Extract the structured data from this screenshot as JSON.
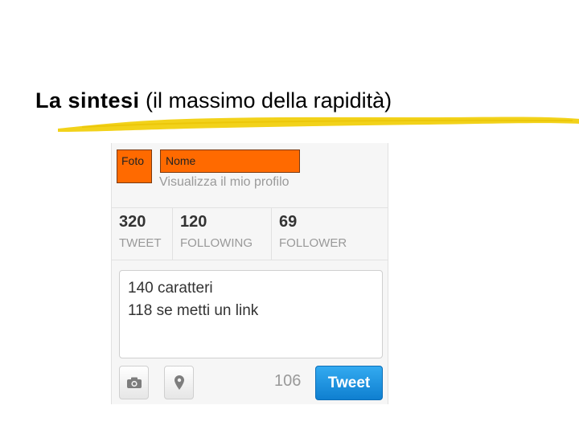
{
  "slide": {
    "title_bold": "La sintesi",
    "title_rest": " (il massimo della rapidità)"
  },
  "profile": {
    "photo_label": "Foto",
    "name_label": "Nome",
    "profile_link": "Visualizza il mio profilo"
  },
  "stats": [
    {
      "value": "320",
      "label": "TWEET"
    },
    {
      "value": "120",
      "label": "FOLLOWING"
    },
    {
      "value": "69",
      "label": "FOLLOWER"
    }
  ],
  "composer": {
    "line1": "140 caratteri",
    "line2": "118 se metti un link"
  },
  "toolbar": {
    "camera_icon": "camera-icon",
    "location_icon": "location-pin-icon",
    "char_count": "106",
    "tweet_label": "Tweet"
  },
  "colors": {
    "highlight": "#f2d21a",
    "placeholder_orange": "#ff6a00",
    "tweet_button": "#1d8fe0"
  }
}
